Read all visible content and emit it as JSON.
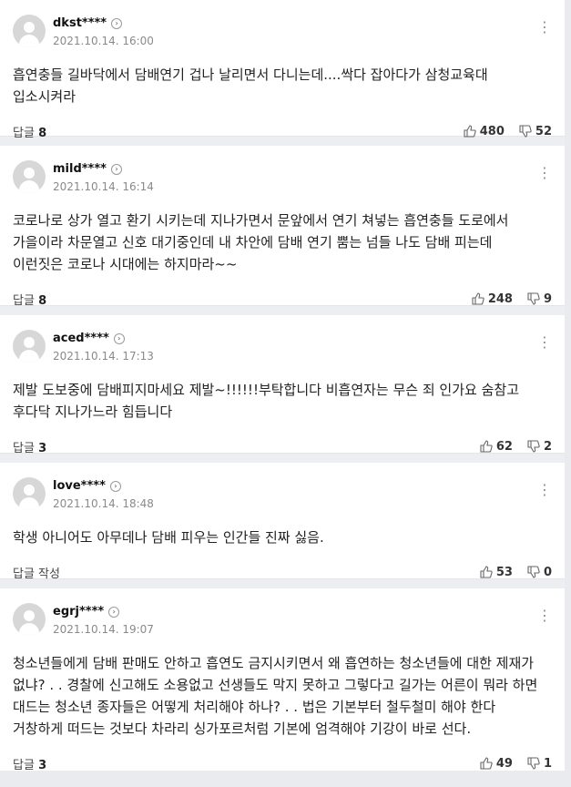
{
  "comments": [
    {
      "nick": "dkst****",
      "date": "2021.10.14. 16:00",
      "text": "흡연충들 길바닥에서 담배연기 겁나 날리면서 다니는데....싹다 잡아다가 삼청교육대 입소시켜라",
      "reply_label": "답글",
      "reply_count": "8",
      "like": "480",
      "dislike": "52"
    },
    {
      "nick": "mild****",
      "date": "2021.10.14. 16:14",
      "text": "코로나로 상가 열고 환기 시키는데 지나가면서 문앞에서 연기 쳐넣는 흡연충들 도로에서 가을이라 차문열고 신호 대기중인데 내 차안에 담배 연기 뿜는 넘들 나도 담배 피는데 이런짓은 코로나 시대에는 하지마라~~",
      "reply_label": "답글",
      "reply_count": "8",
      "like": "248",
      "dislike": "9"
    },
    {
      "nick": "aced****",
      "date": "2021.10.14. 17:13",
      "text": "제발 도보중에 담배피지마세요 제발~!!!!!!부탁합니다 비흡연자는 무슨 죄 인가요 숨참고 후다닥 지나가느라 힘듭니다",
      "reply_label": "답글",
      "reply_count": "3",
      "like": "62",
      "dislike": "2"
    },
    {
      "nick": "love****",
      "date": "2021.10.14. 18:48",
      "text": "학생 아니어도 아무데나 담배 피우는 인간들 진짜 싫음.",
      "reply_label": "답글 작성",
      "reply_count": "",
      "like": "53",
      "dislike": "0"
    },
    {
      "nick": "egrj****",
      "date": "2021.10.14. 19:07",
      "text": "청소년들에게 담배 판매도 안하고 흡연도 금지시키면서 왜 흡연하는 청소년들에 대한 제재가 없냐? . . 경찰에 신고해도 소용없고 선생들도 막지 못하고 그렇다고 길가는 어른이 뭐라 하면 대드는 청소년 종자들은 어떻게 처리해야 하나? . . 법은 기본부터 철두철미 해야 한다 거창하게 떠드는 것보다 차라리 싱가포르처럼 기본에 엄격해야 기강이 바로 선다.",
      "reply_label": "답글",
      "reply_count": "3",
      "like": "49",
      "dislike": "1"
    }
  ],
  "icons": {
    "more": "more-vertical-icon",
    "chevron": "chevron-right-icon",
    "like": "thumbs-up-icon",
    "dislike": "thumbs-down-icon"
  }
}
